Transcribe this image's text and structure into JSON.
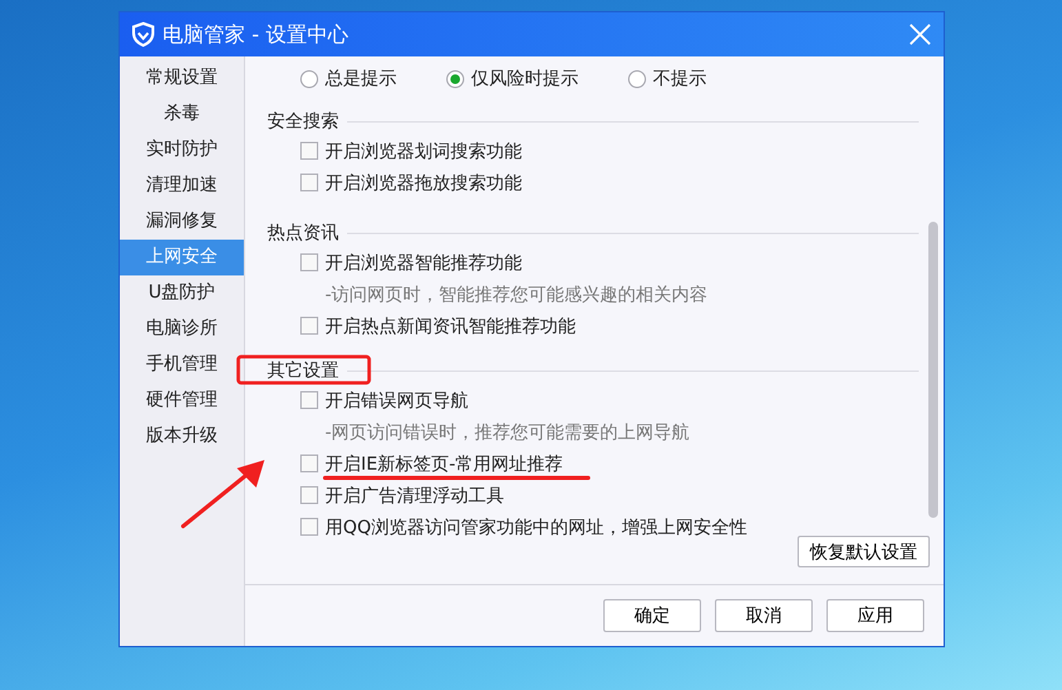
{
  "window": {
    "title": "电脑管家 - 设置中心"
  },
  "sidebar": {
    "items": [
      {
        "label": "常规设置",
        "selected": false
      },
      {
        "label": "杀毒",
        "selected": false
      },
      {
        "label": "实时防护",
        "selected": false
      },
      {
        "label": "清理加速",
        "selected": false
      },
      {
        "label": "漏洞修复",
        "selected": false
      },
      {
        "label": "上网安全",
        "selected": true
      },
      {
        "label": "U盘防护",
        "selected": false
      },
      {
        "label": "电脑诊所",
        "selected": false
      },
      {
        "label": "手机管理",
        "selected": false
      },
      {
        "label": "硬件管理",
        "selected": false
      },
      {
        "label": "版本升级",
        "selected": false
      }
    ]
  },
  "prompt_options": [
    {
      "label": "总是提示",
      "selected": false
    },
    {
      "label": "仅风险时提示",
      "selected": true
    },
    {
      "label": "不提示",
      "selected": false
    }
  ],
  "sections": [
    {
      "heading": "安全搜索",
      "items": [
        {
          "kind": "checkbox",
          "label": "开启浏览器划词搜索功能",
          "checked": false
        },
        {
          "kind": "checkbox",
          "label": "开启浏览器拖放搜索功能",
          "checked": false
        }
      ]
    },
    {
      "heading": "热点资讯",
      "items": [
        {
          "kind": "checkbox",
          "label": "开启浏览器智能推荐功能",
          "checked": false
        },
        {
          "kind": "note",
          "label": "-访问网页时，智能推荐您可能感兴趣的相关内容"
        },
        {
          "kind": "checkbox",
          "label": "开启热点新闻资讯智能推荐功能",
          "checked": false
        }
      ]
    },
    {
      "heading": "其它设置",
      "items": [
        {
          "kind": "checkbox",
          "label": "开启错误网页导航",
          "checked": false
        },
        {
          "kind": "note",
          "label": "-网页访问错误时，推荐您可能需要的上网导航"
        },
        {
          "kind": "checkbox",
          "label": "开启IE新标签页-常用网址推荐",
          "checked": false
        },
        {
          "kind": "checkbox",
          "label": "开启广告清理浮动工具",
          "checked": false
        },
        {
          "kind": "checkbox",
          "label": "用QQ浏览器访问管家功能中的网址，增强上网安全性",
          "checked": false
        }
      ]
    }
  ],
  "restore_button": "恢复默认设置",
  "buttons": [
    "确定",
    "取消",
    "应用"
  ],
  "annotations": [
    {
      "kind": "box"
    },
    {
      "kind": "arrow"
    },
    {
      "kind": "underline"
    }
  ]
}
